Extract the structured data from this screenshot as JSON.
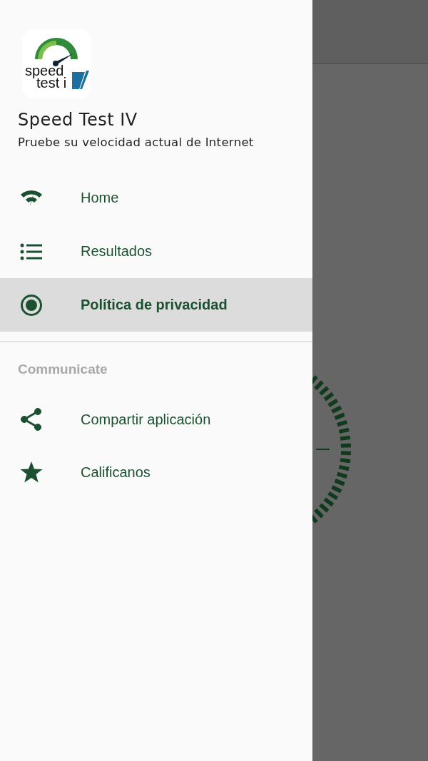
{
  "drawer": {
    "logo": {
      "lines": [
        "speed",
        "test i"
      ]
    },
    "title": "Speed Test IV",
    "subtitle": "Pruebe su velocidad actual de Internet",
    "items": [
      {
        "label": "Home",
        "selected": false
      },
      {
        "label": "Resultados",
        "selected": false
      },
      {
        "label": "Política de privacidad",
        "selected": true
      }
    ],
    "section": {
      "header": "Communicate",
      "items": [
        {
          "label": "Compartir aplicación",
          "selected": false
        },
        {
          "label": "Calificanos",
          "selected": false
        }
      ]
    }
  }
}
